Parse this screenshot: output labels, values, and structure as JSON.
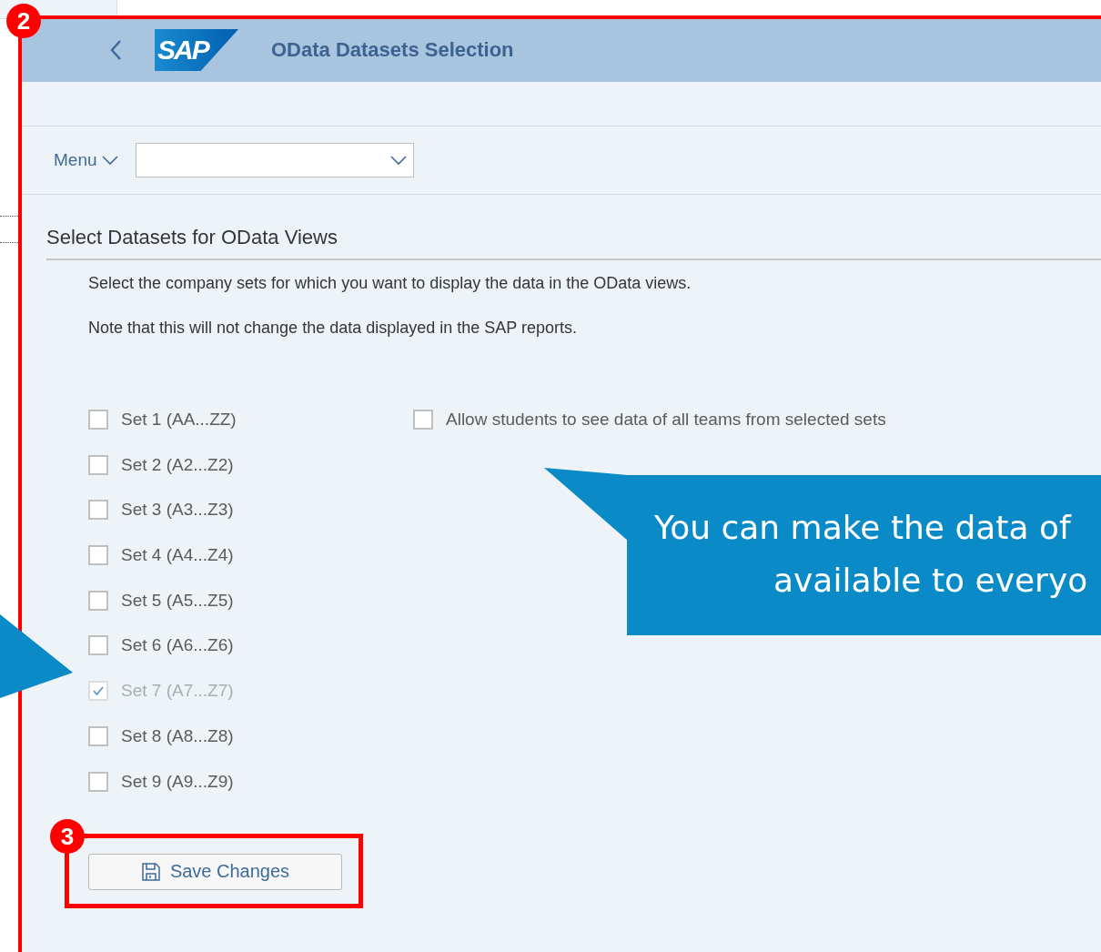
{
  "markers": [
    {
      "label": "2"
    },
    {
      "label": "3"
    }
  ],
  "header": {
    "title": "OData Datasets Selection",
    "logo": "SAP"
  },
  "toolbar": {
    "menu_label": "Menu"
  },
  "section": {
    "title": "Select Datasets for OData Views",
    "notes": [
      "Select the company sets for which you want to display the data in the OData views.",
      "Note that this will not change the data displayed in the SAP reports."
    ]
  },
  "sets": [
    {
      "label": "Set 1 (AA...ZZ)",
      "checked": false,
      "disabled": false
    },
    {
      "label": "Set 2 (A2...Z2)",
      "checked": false,
      "disabled": false
    },
    {
      "label": "Set 3 (A3...Z3)",
      "checked": false,
      "disabled": false
    },
    {
      "label": "Set 4 (A4...Z4)",
      "checked": false,
      "disabled": false
    },
    {
      "label": "Set 5 (A5...Z5)",
      "checked": false,
      "disabled": false
    },
    {
      "label": "Set 6 (A6...Z6)",
      "checked": false,
      "disabled": false
    },
    {
      "label": "Set 7 (A7...Z7)",
      "checked": true,
      "disabled": true
    },
    {
      "label": "Set 8 (A8...Z8)",
      "checked": false,
      "disabled": false
    },
    {
      "label": "Set 9 (A9...Z9)",
      "checked": false,
      "disabled": false
    }
  ],
  "allow_option": {
    "label": "Allow students to see data of all teams from selected sets",
    "checked": false
  },
  "save_button": {
    "label": "Save Changes"
  },
  "callout": {
    "lines": [
      "You can make the data of",
      "available to everyo"
    ]
  }
}
